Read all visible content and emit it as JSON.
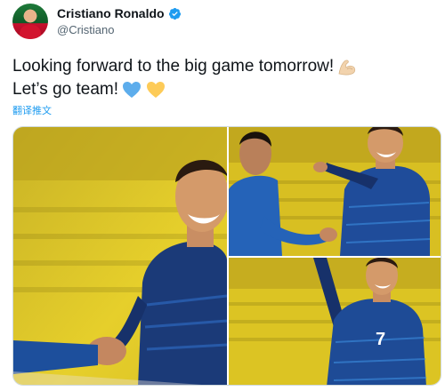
{
  "author": {
    "display_name": "Cristiano Ronaldo",
    "handle": "@Cristiano",
    "verified_icon": "verified-badge-icon",
    "verified_color": "#1d9bf0"
  },
  "tweet": {
    "line1": "Looking forward to the big game tomorrow!",
    "line1_emoji": "flexed-biceps-icon",
    "line2": "Let’s go team!",
    "line2_emojis": [
      "blue-heart-icon",
      "yellow-heart-icon"
    ],
    "translate_label": "翻译推文"
  },
  "media": {
    "photos": [
      {
        "name": "photo-handshake-smile",
        "jersey_color": "#1d3f82"
      },
      {
        "name": "photo-pointing-teammate",
        "jersey_color": "#1f4c9a"
      },
      {
        "name": "photo-jersey-number",
        "jersey_number": "7"
      }
    ],
    "stadium_color": "#e2c21b"
  },
  "colors": {
    "text": "#0f1419",
    "secondary": "#536471",
    "link": "#1d9bf0"
  }
}
